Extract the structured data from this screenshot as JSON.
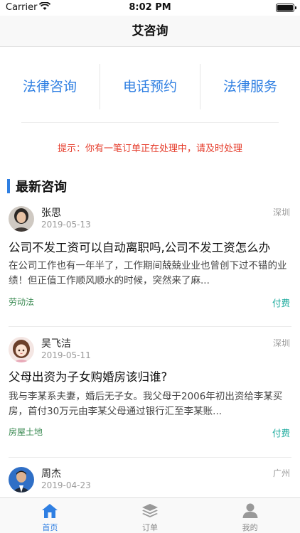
{
  "status_bar": {
    "carrier": "Carrier",
    "time": "8:02 PM"
  },
  "nav": {
    "title": "艾咨询"
  },
  "menu": {
    "items": [
      {
        "label": "法律咨询"
      },
      {
        "label": "电话预约"
      },
      {
        "label": "法律服务"
      }
    ]
  },
  "notice": "提示：你有一笔订单正在处理中，请及时处理",
  "section": {
    "title": "最新咨询"
  },
  "consultations": [
    {
      "name": "张思",
      "date": "2019-05-13",
      "city": "深圳",
      "title": "公司不发工资可以自动离职吗,公司不发工资怎么办",
      "desc": "在公司工作也有一年半了，工作期间兢兢业业也曾创下过不错的业绩！但正值工作顺风顺水的时候，突然来了麻...",
      "category": "劳动法",
      "fee": "付费"
    },
    {
      "name": "吴飞洁",
      "date": "2019-05-11",
      "city": "深圳",
      "title": "父母出资为子女购婚房该归谁?",
      "desc": "我与李某系夫妻，婚后无子女。我父母于2006年初出资给李某买房，首付30万元由李某父母通过银行汇至李某账...",
      "category": "房屋土地",
      "fee": "付费"
    },
    {
      "name": "周杰",
      "date": "2019-04-23",
      "city": "广州"
    }
  ],
  "tab_bar": {
    "items": [
      {
        "label": "首页"
      },
      {
        "label": "订单"
      },
      {
        "label": "我的"
      }
    ]
  },
  "colors": {
    "accent": "#2f7fe2",
    "notice": "#e53b2a",
    "fee": "#15a89a",
    "category": "#3a8a52"
  }
}
